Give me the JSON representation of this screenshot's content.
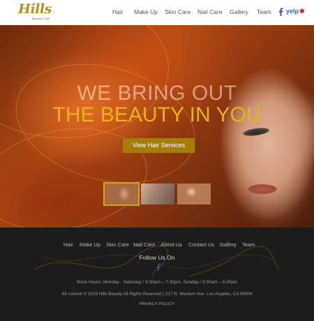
{
  "header": {
    "logo": {
      "main": "Hills",
      "sub": "Beauty Club"
    },
    "nav": [
      "Hair",
      "Make Up",
      "Skin Care",
      "Nail Care",
      "Gallery",
      "Team"
    ],
    "social": {
      "facebook_icon": "facebook-icon",
      "yelp_label": "yelp"
    }
  },
  "hero": {
    "line1": "WE BRING OUT",
    "line2": "THE BEAUTY IN YOU",
    "button_label": "View Hair Services",
    "thumbnails": [
      "thumbnail-1",
      "thumbnail-2",
      "thumbnail-3"
    ],
    "active_thumbnail": 1
  },
  "footer": {
    "nav": [
      "Hair",
      "Make Up",
      "Skin Care",
      "Nail Care",
      "About Us",
      "Contact Us",
      "Gallery",
      "Team"
    ],
    "follow_label": "Follow Us On",
    "hours": "Store Hours: Monday - Saturday / 9:30am – 7:30pm, Sunday / 9:30am – 6:30pm",
    "copyright": "All content © 2015 Hills Beauty All Rights Reserved | 217 N. Western Ave. Los Angeles, CA 90004",
    "privacy": "PRIVACY POLICY"
  },
  "colors": {
    "accent": "#a57e07",
    "hero_title_gold": "#e6b219",
    "logo_gold": "#b98f1e",
    "footer_bg": "#1d1c1c"
  }
}
